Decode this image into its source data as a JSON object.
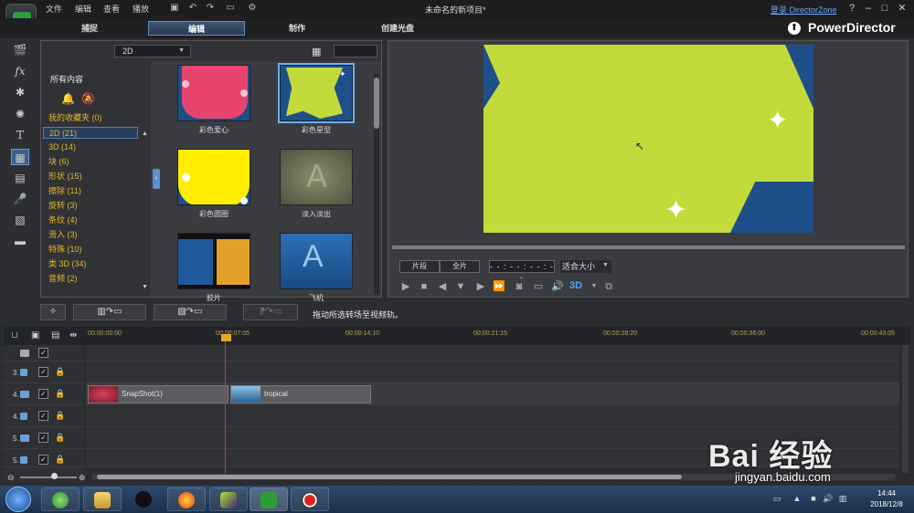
{
  "window": {
    "title": "未命名的新项目*",
    "menu": [
      "文件",
      "编辑",
      "查看",
      "播放"
    ],
    "login_link": "登录 DirectorZone",
    "help": "?"
  },
  "tabs": [
    {
      "label": "捕捉",
      "active": false
    },
    {
      "label": "编辑",
      "active": true
    },
    {
      "label": "制作",
      "active": false
    },
    {
      "label": "创建光盘",
      "active": false
    }
  ],
  "brand": {
    "name": "PowerDirector"
  },
  "library": {
    "filter_select": "2D",
    "category_title": "所有内容",
    "categories": [
      {
        "label": "我的收藏夹  (0)"
      },
      {
        "label": "2D  (21)",
        "selected": true
      },
      {
        "label": "3D  (14)"
      },
      {
        "label": "块  (6)"
      },
      {
        "label": "形状  (15)"
      },
      {
        "label": "擦除  (11)"
      },
      {
        "label": "旋转  (3)"
      },
      {
        "label": "条纹  (4)"
      },
      {
        "label": "滑入  (3)"
      },
      {
        "label": "特殊  (10)"
      },
      {
        "label": "类 3D  (34)"
      },
      {
        "label": "音频  (2)"
      }
    ],
    "thumbnails": [
      {
        "label": "彩色爱心"
      },
      {
        "label": "彩色星型"
      },
      {
        "label": "彩色圆圈"
      },
      {
        "label": "淡入淡出"
      },
      {
        "label": "胶片"
      },
      {
        "label": "飞机"
      }
    ]
  },
  "preview": {
    "clip_button": "片段",
    "movie_button": "全片",
    "timecode": "- - : - - : - - : - -",
    "fit_select": "适合大小",
    "mode_3d": "3D",
    "screen_color": "#c3db3a"
  },
  "toolrow": {
    "hint": "拖动所选转场至视频轨。"
  },
  "timeline": {
    "ruler_ticks": [
      "00:00:00:00",
      "00:00:07:05",
      "00:00:14:10",
      "00:00:21:15",
      "00:00:28:20",
      "00:00:36:00",
      "00:00:43:05"
    ],
    "tracks": [
      {
        "num": "",
        "check": "✓"
      },
      {
        "num": "3.",
        "check": "✓"
      },
      {
        "num": "4.",
        "check": "✓"
      },
      {
        "num": "4.",
        "check": "✓"
      },
      {
        "num": "5.",
        "check": "✓"
      },
      {
        "num": "5.",
        "check": "✓"
      }
    ],
    "clips": [
      {
        "label": "SnapShot(1)"
      },
      {
        "label": "tropical"
      }
    ]
  },
  "taskbar": {
    "time": "14:44",
    "date": "2018/12/8"
  },
  "watermark": {
    "text": "Bai 经验",
    "url": "jingyan.baidu.com"
  }
}
